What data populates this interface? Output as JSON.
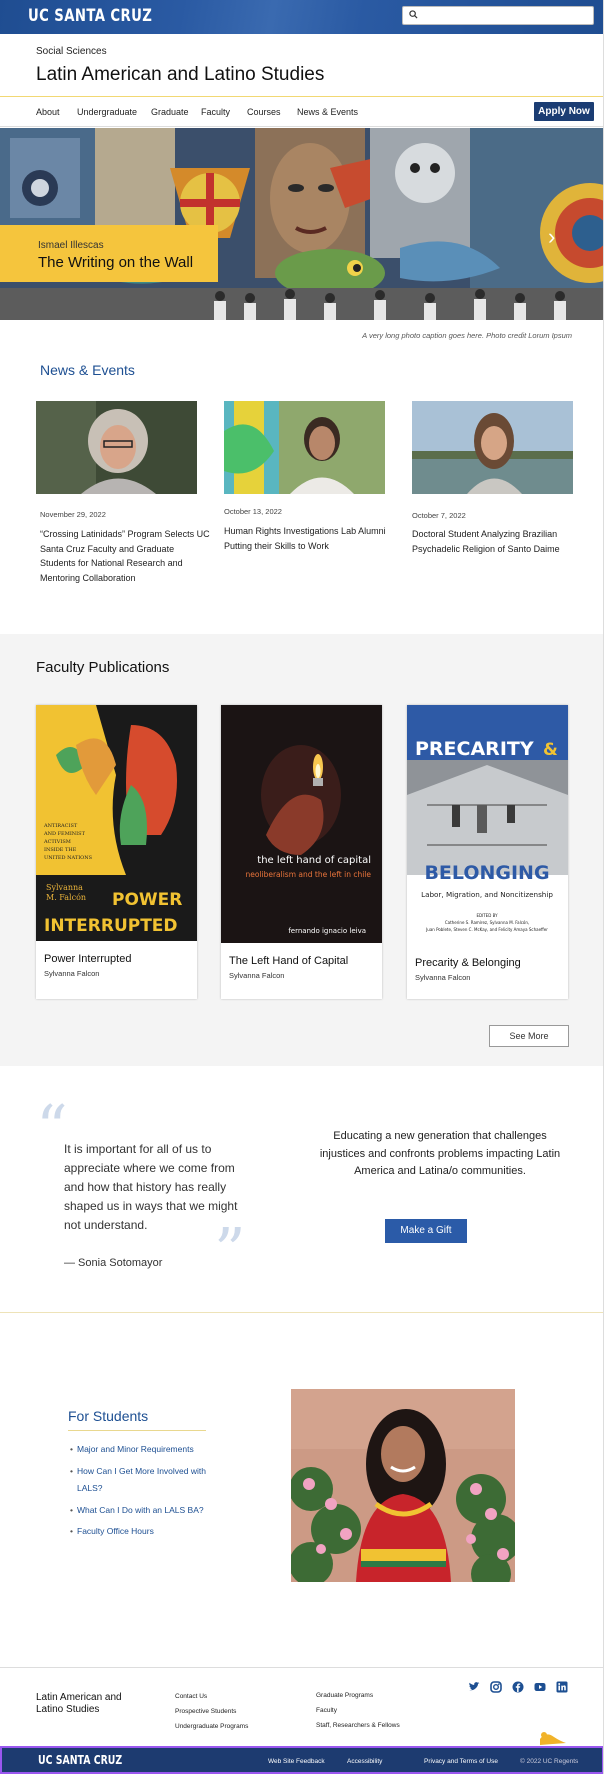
{
  "header": {
    "logo": "UC SANTA CRUZ",
    "search_placeholder": ""
  },
  "dept": {
    "division": "Social Sciences",
    "title": "Latin American and Latino Studies"
  },
  "nav": {
    "items": [
      "About",
      "Undergraduate",
      "Graduate",
      "Faculty",
      "Courses",
      "News & Events"
    ],
    "apply": "Apply Now"
  },
  "hero": {
    "subtitle": "Ismael Illescas",
    "title": "The Writing on the Wall",
    "caption": "A very long photo caption goes here. Photo credit Lorum Ipsum",
    "arrow": "›"
  },
  "news": {
    "heading": "News & Events",
    "items": [
      {
        "date": "November 29, 2022",
        "title": "“Crossing Latinidads” Program Selects UC Santa Cruz Faculty and Graduate Students for National Research and Mentoring Collaboration"
      },
      {
        "date": "October 13, 2022",
        "title": "Human Rights Investigations Lab Alumni Putting their Skills to Work"
      },
      {
        "date": "October 7, 2022",
        "title": "Doctoral Student Analyzing Brazilian Psychadelic Religion of Santo Daime"
      }
    ]
  },
  "publications": {
    "heading": "Faculty Publications",
    "items": [
      {
        "title": "Power Interrupted",
        "author": "Sylvanna Falcon",
        "cover_author": "Sylvanna M. Falcón",
        "cover_title": "POWER INTERRUPTED",
        "cover_sub": "ANTIRACIST AND FEMINIST ACTIVISM INSIDE THE UNITED NATIONS"
      },
      {
        "title": "The Left Hand of Capital",
        "author": "Sylvanna Falcon",
        "cover_title": "the left hand of capital",
        "cover_sub": "neoliberalism and the left in chile",
        "cover_author": "fernando ignacio leiva"
      },
      {
        "title": "Precarity & Belonging",
        "author": "Sylvanna Falcon",
        "cover_title1": "PRECARITY&",
        "cover_title2": "BELONGING",
        "cover_sub": "Labor, Migration, and Noncitizenship",
        "cover_edited": "EDITED BY",
        "cover_editors": "Catherine S. Ramírez, Sylvanna M. Falcón, Juan Poblete, Steven C. McKay, and Felicity Amaya Schaeffer"
      }
    ],
    "see_more": "See More"
  },
  "quote": {
    "text": "It is important for all of us to appreciate where we come from and how that history has really shaped us in ways that we might not understand.",
    "author": "— Sonia Sotomayor",
    "open": "“",
    "close": "”"
  },
  "gift": {
    "text": "Educating a new generation that challenges injustices and confronts problems impacting Latin America and Latina/o communities.",
    "button": "Make a Gift"
  },
  "students": {
    "heading": "For Students",
    "bullet": "•",
    "items": [
      "Major and Minor Requirements",
      "How Can I Get More Involved with LALS?",
      "What Can I Do with an LALS BA?",
      "Faculty Office Hours"
    ]
  },
  "footer": {
    "name": "Latin American and Latino Studies",
    "col1": [
      "Contact Us",
      "Prospective Students",
      "Undergraduate Programs"
    ],
    "col2": [
      "Graduate Programs",
      "Faculty",
      "Staff, Researchers & Fellows"
    ],
    "social": [
      "twitter-icon",
      "instagram-icon",
      "facebook-icon",
      "youtube-icon",
      "linkedin-icon"
    ]
  },
  "bottom": {
    "logo": "UC SANTA CRUZ",
    "links": [
      "Web Site Feedback",
      "Accessibility",
      "Privacy and Terms of Use"
    ],
    "copyright": "© 2022 UC Regents"
  },
  "colors": {
    "brand_blue": "#1d3b70",
    "accent_gold": "#f5c53d",
    "link_blue": "#1d4f92"
  }
}
